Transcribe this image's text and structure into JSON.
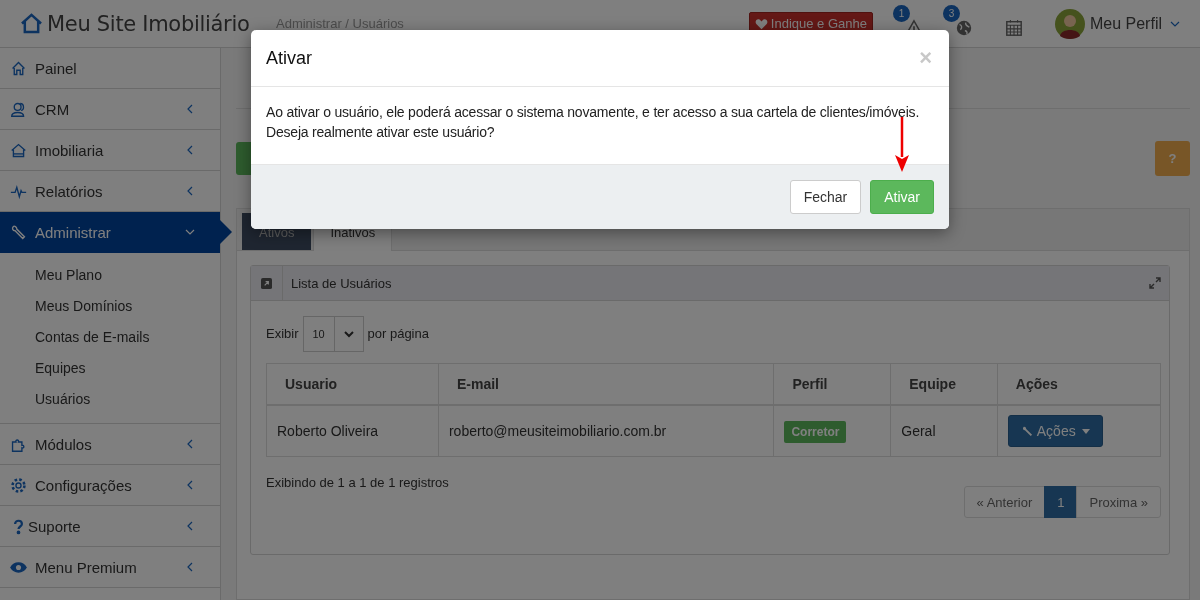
{
  "header": {
    "logo": "Meu Site Imobiliário",
    "breadcrumb": "Administrar / Usuários",
    "promo": "Indique e Ganhe",
    "notifications": [
      {
        "kind": "alert",
        "badge": "1"
      },
      {
        "kind": "globe",
        "badge": "3"
      },
      {
        "kind": "calendar"
      }
    ],
    "profile": "Meu Perfil"
  },
  "sidebar": {
    "items": [
      {
        "label": "Painel",
        "kind": "home",
        "selected": false
      },
      {
        "label": "CRM",
        "kind": "users",
        "selected": false,
        "expanded": false
      },
      {
        "label": "Imobiliaria",
        "kind": "house",
        "selected": false,
        "expanded": false
      },
      {
        "label": "Relatórios",
        "kind": "pulse",
        "selected": false,
        "expanded": false
      },
      {
        "label": "Administrar",
        "kind": "wrench",
        "selected": true,
        "expanded": true,
        "children": [
          "Meu Plano",
          "Meus Domínios",
          "Contas de E-mails",
          "Equipes",
          "Usuários"
        ]
      },
      {
        "label": "Módulos",
        "kind": "puzzle",
        "selected": false,
        "expanded": false
      },
      {
        "label": "Configurações",
        "kind": "gear",
        "selected": false,
        "expanded": false
      },
      {
        "label": "Suporte",
        "kind": "question",
        "selected": false,
        "expanded": false
      },
      {
        "label": "Menu Premium",
        "kind": "eye",
        "selected": false,
        "expanded": false
      }
    ]
  },
  "content": {
    "help": "?",
    "tabs": [
      {
        "label": "Ativos",
        "selected": false
      },
      {
        "label": "Inativos",
        "selected": true
      }
    ],
    "panel": {
      "title": "Lista de Usuários",
      "show_label": "Exibir",
      "page_size": "10",
      "per_page_label": "por página",
      "columns": [
        "Usuario",
        "E-mail",
        "Perfil",
        "Equipe",
        "Ações"
      ],
      "rows": [
        {
          "name": "Roberto Oliveira",
          "email": "roberto@meusiteimobiliario.com.br",
          "role": "Corretor",
          "team": "Geral",
          "action": "Ações"
        }
      ],
      "summary": "Exibindo de 1 a 1 de 1 registros",
      "pagination": {
        "previous": "« Anterior",
        "pages": [
          {
            "label": "1",
            "selected": true
          }
        ],
        "next": "Proxima »"
      }
    }
  },
  "modal": {
    "title": "Ativar",
    "close": "×",
    "lines": [
      "Ao ativar o usuário, ele poderá acessar o sistema novamente, e ter acesso a sua cartela de clientes/imóveis.",
      "Deseja realmente ativar este usuário?"
    ],
    "buttons": [
      {
        "label": "Fechar",
        "kind": "default"
      },
      {
        "label": "Ativar",
        "kind": "primary"
      }
    ]
  }
}
